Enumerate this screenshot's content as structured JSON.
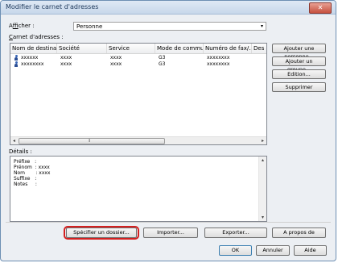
{
  "window": {
    "title": "Modifier le carnet d'adresses",
    "close_glyph": "✕"
  },
  "afficher": {
    "label_pre": "A",
    "label_u": "f",
    "label_post": "ficher :",
    "value": "Personne",
    "arrow": "▾"
  },
  "carnet": {
    "label_pre": "",
    "label_u": "C",
    "label_post": "arnet d'adresses :"
  },
  "table": {
    "columns": [
      "Nom de destinati...",
      "Société",
      "Service",
      "Mode de commu...",
      "Numéro de fax/...",
      "Des"
    ],
    "rows": [
      [
        "xxxxxx",
        "xxxx",
        "xxxx",
        "G3",
        "xxxxxxxx"
      ],
      [
        "xxxxxxxx",
        "xxxx",
        "xxxx",
        "G3",
        "xxxxxxxx"
      ]
    ],
    "scroll_left": "◂",
    "scroll_right": "▸",
    "grip": "⦀"
  },
  "side_buttons": {
    "add_person": "Ajouter une personne...",
    "add_group": "Ajouter un groupe...",
    "edit": "Edition...",
    "delete": "Supprimer"
  },
  "details": {
    "label": "Détails :",
    "lines": [
      "Préfixe   :",
      "Prénom  : xxxx",
      "Nom       : xxxx",
      "Suffixe   :",
      "Notes     :"
    ],
    "scroll_up": "▴",
    "scroll_down": "▾"
  },
  "bottom_buttons": {
    "specify_folder": "Spécifier un dossier...",
    "import": "Importer...",
    "export": "Exporter...",
    "about": "A propos de",
    "ok": "OK",
    "cancel": "Annuler",
    "help": "Aide"
  }
}
